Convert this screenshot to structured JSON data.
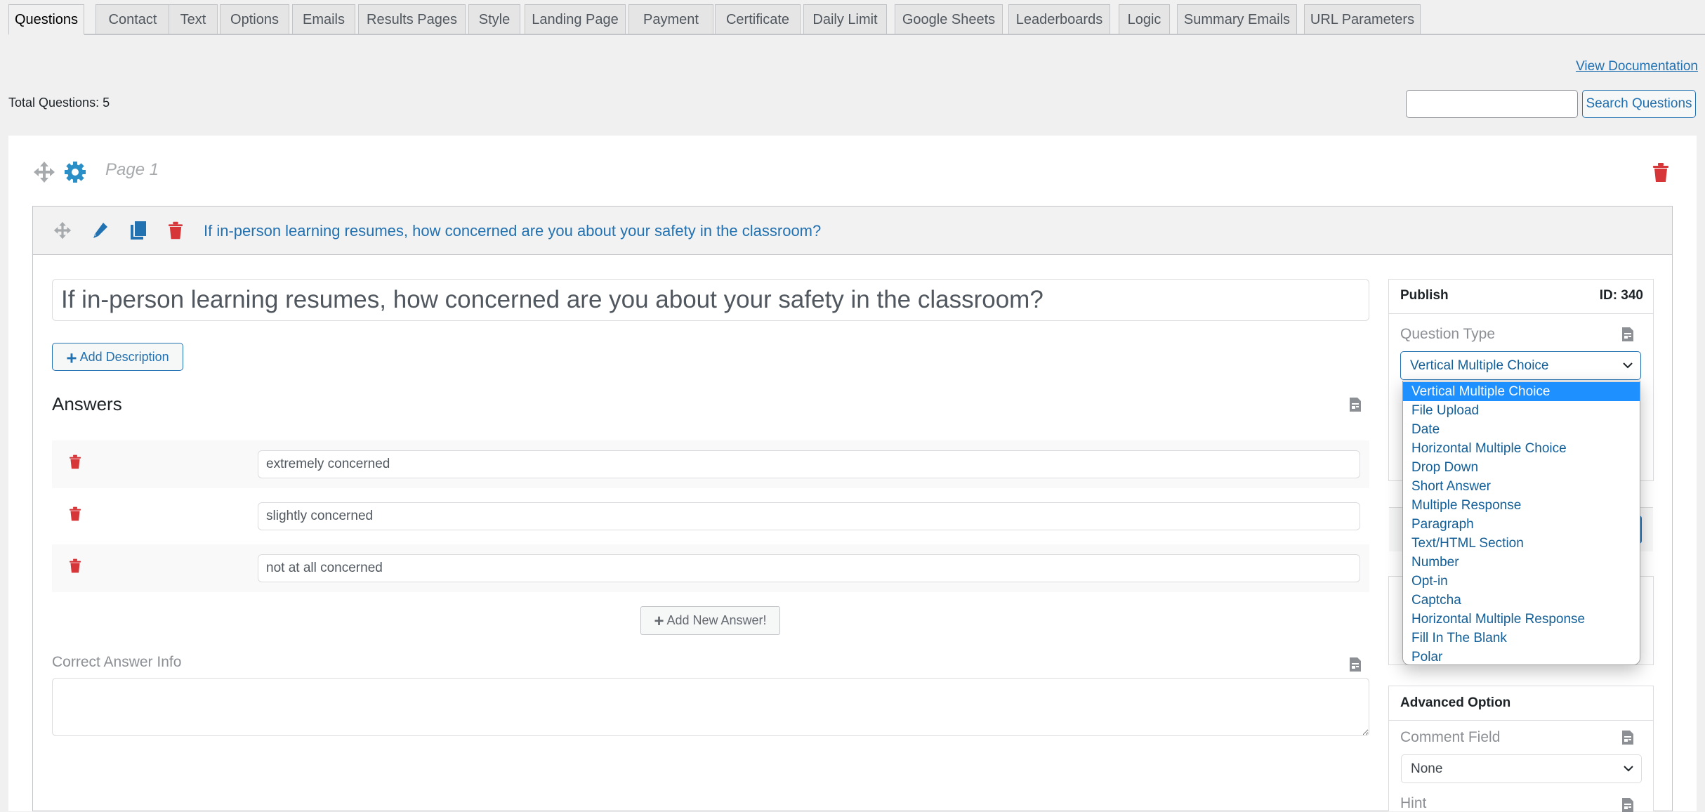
{
  "tabs": [
    {
      "label": "Questions",
      "active": true
    },
    {
      "label": "Contact"
    },
    {
      "label": "Text"
    },
    {
      "label": "Options"
    },
    {
      "label": "Emails"
    },
    {
      "label": "Results Pages"
    },
    {
      "label": "Style"
    },
    {
      "label": "Landing Page"
    },
    {
      "label": "Payment"
    },
    {
      "label": "Certificate"
    },
    {
      "label": "Daily Limit"
    },
    {
      "label": "Google Sheets"
    },
    {
      "label": "Leaderboards"
    },
    {
      "label": "Logic"
    },
    {
      "label": "Summary Emails"
    },
    {
      "label": "URL Parameters"
    }
  ],
  "header": {
    "view_documentation": "View Documentation",
    "total_questions_label": "Total Questions:",
    "total_questions_value": "5",
    "search_value": "",
    "search_button": "Search Questions"
  },
  "page": {
    "title": "Page 1",
    "icons": [
      "move-icon",
      "gear-icon",
      "trash-icon"
    ]
  },
  "question": {
    "header_title": "If in-person learning resumes, how concerned are you about your safety in the classroom?",
    "title_value": "If in-person learning resumes, how concerned are you about your safety in the classroom?",
    "add_description": "Add Description",
    "answers_heading": "Answers",
    "answers": [
      {
        "value": "extremely concerned"
      },
      {
        "value": "slightly concerned"
      },
      {
        "value": "not at all concerned"
      }
    ],
    "add_new_answer": "Add New Answer!",
    "correct_answer_info_label": "Correct Answer Info",
    "correct_answer_info_value": ""
  },
  "sidebar": {
    "publish_label": "Publish",
    "id_label": "ID: 340",
    "question_type_label": "Question Type",
    "question_type_selected": "Vertical Multiple Choice",
    "question_type_options": [
      "Vertical Multiple Choice",
      "File Upload",
      "Date",
      "Horizontal Multiple Choice",
      "Drop Down",
      "Short Answer",
      "Multiple Response",
      "Paragraph",
      "Text/HTML Section",
      "Number",
      "Opt-in",
      "Captcha",
      "Horizontal Multiple Response",
      "Fill In The Blank",
      "Polar"
    ],
    "advanced_option_label": "Advanced Option",
    "comment_field_label": "Comment Field",
    "comment_field_selected": "None",
    "hint_label": "Hint"
  },
  "colors": {
    "accent": "#2271b1",
    "delete": "#d63638",
    "gear": "#2a8fc7",
    "selected_option": "#1e90ff"
  }
}
